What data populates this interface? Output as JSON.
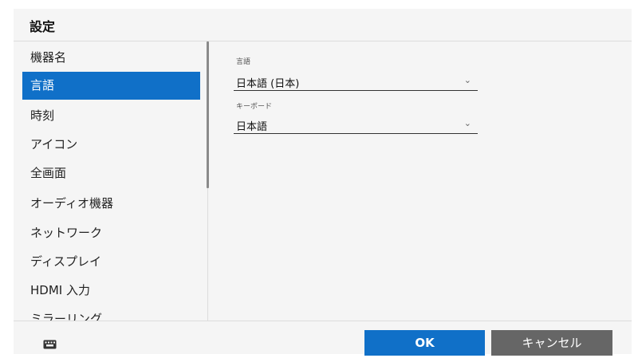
{
  "dialog": {
    "title": "設定"
  },
  "sidebar": {
    "items": [
      {
        "label": "機器名",
        "selected": false
      },
      {
        "label": "言語",
        "selected": true
      },
      {
        "label": "時刻",
        "selected": false
      },
      {
        "label": "アイコン",
        "selected": false
      },
      {
        "label": "全画面",
        "selected": false
      },
      {
        "label": "オーディオ機器",
        "selected": false
      },
      {
        "label": "ネットワーク",
        "selected": false
      },
      {
        "label": "ディスプレイ",
        "selected": false
      },
      {
        "label": "HDMI 入力",
        "selected": false
      },
      {
        "label": "ミラーリング",
        "selected": false
      }
    ]
  },
  "language_panel": {
    "language": {
      "label": "言語",
      "value": "日本語 (日本)"
    },
    "keyboard": {
      "label": "キーボード",
      "value": "日本語"
    }
  },
  "footer": {
    "keyboard_icon": "keyboard-icon",
    "ok_label": "OK",
    "cancel_label": "キャンセル"
  },
  "colors": {
    "accent": "#1070c8",
    "cancel_button": "#666666",
    "background": "#f5f5f5"
  }
}
